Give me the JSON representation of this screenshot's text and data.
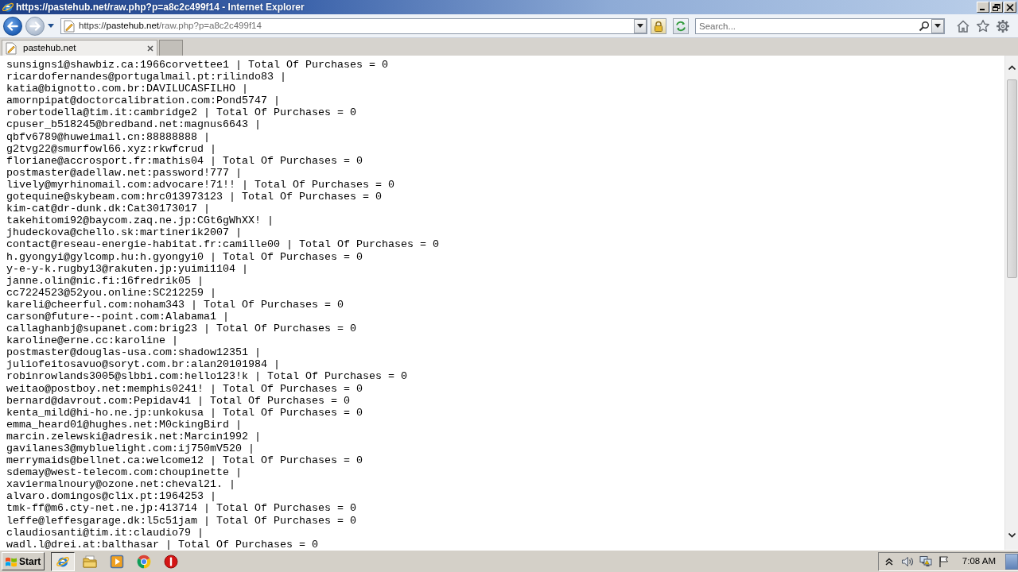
{
  "window": {
    "title": "https://pastehub.net/raw.php?p=a8c2c499f14 - Internet Explorer"
  },
  "address_bar": {
    "scheme": "https://",
    "host": "pastehub.net",
    "path": "/raw.php?p=a8c2c499f14"
  },
  "search": {
    "placeholder": "Search..."
  },
  "tabs": [
    {
      "label": "pastehub.net",
      "selected": true
    }
  ],
  "content": {
    "lines": [
      "sunsigns1@shawbiz.ca:1966corvettee1 | Total Of Purchases = 0",
      "ricardofernandes@portugalmail.pt:rilindo83 |",
      "katia@bignotto.com.br:DAVILUCASFILHO |",
      "amornpipat@doctorcalibration.com:Pond5747 |",
      "robertodella@tim.it:cambridge2 | Total Of Purchases = 0",
      "cpuser_b518245@bredband.net:magnus6643 |",
      "qbfv6789@huweimail.cn:88888888 |",
      "g2tvg22@smurfowl66.xyz:rkwfcrud |",
      "floriane@accrosport.fr:mathis04 | Total Of Purchases = 0",
      "postmaster@adellaw.net:password!777 |",
      "lively@myrhinomail.com:advocare!71!! | Total Of Purchases = 0",
      "gotequine@skybeam.com:hrc013973123 | Total Of Purchases = 0",
      "kim-cat@dr-dunk.dk:Cat30173017 |",
      "takehitomi92@baycom.zaq.ne.jp:CGt6gWhXX! |",
      "jhudeckova@chello.sk:martinerik2007 |",
      "contact@reseau-energie-habitat.fr:camille00 | Total Of Purchases = 0",
      "h.gyongyi@gylcomp.hu:h.gyongyi0 | Total Of Purchases = 0",
      "y-e-y-k.rugby13@rakuten.jp:yuimi1104 |",
      "janne.olin@nic.fi:16fredrik05 |",
      "cc7224523@52you.online:SC212259 |",
      "kareli@cheerful.com:noham343 | Total Of Purchases = 0",
      "carson@future--point.com:Alabama1 |",
      "callaghanbj@supanet.com:brig23 | Total Of Purchases = 0",
      "karoline@erne.cc:karoline |",
      "postmaster@douglas-usa.com:shadow12351 |",
      "juliofeitosavuo@soryt.com.br:alan20101984 |",
      "robinrowlands3005@slbbi.com:hello123!k | Total Of Purchases = 0",
      "weitao@postboy.net:memphis0241! | Total Of Purchases = 0",
      "bernard@davrout.com:Pepidav41 | Total Of Purchases = 0",
      "kenta_mild@hi-ho.ne.jp:unkokusa | Total Of Purchases = 0",
      "emma_heard01@hughes.net:M0ckingBird |",
      "marcin.zelewski@adresik.net:Marcin1992 |",
      "gavilanes3@mybluelight.com:ij750mV520 |",
      "merrymaids@bellnet.ca:welcome12 | Total Of Purchases = 0",
      "sdemay@west-telecom.com:choupinette |",
      "xaviermalnoury@ozone.net:cheval21. |",
      "alvaro.domingos@clix.pt:1964253 |",
      "tmk-ff@m6.cty-net.ne.jp:413714 | Total Of Purchases = 0",
      "leffe@leffesgarage.dk:l5c51jam | Total Of Purchases = 0",
      "claudiosanti@tim.it:claudio79 |",
      "wadl.l@drei.at:balthasar | Total Of Purchases = 0"
    ]
  },
  "taskbar": {
    "start": "Start",
    "apps": [
      {
        "selected": true
      },
      {
        "selected": false
      },
      {
        "selected": false
      },
      {
        "selected": false
      },
      {
        "selected": false
      }
    ],
    "clock": "7:08 AM"
  }
}
